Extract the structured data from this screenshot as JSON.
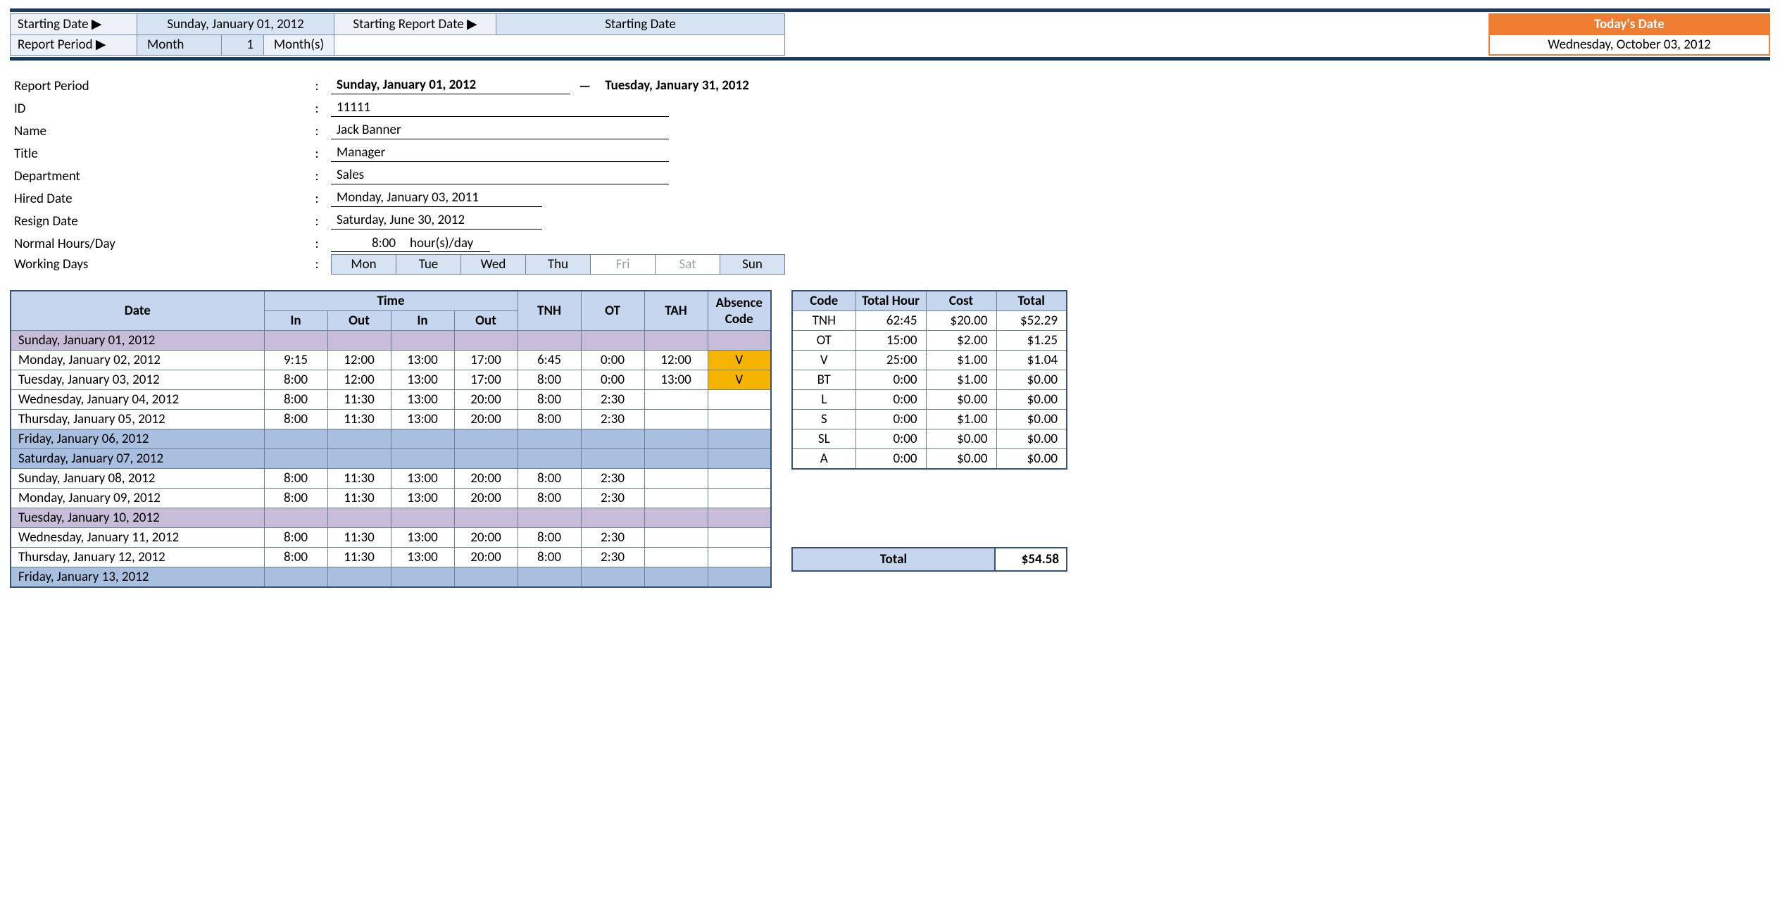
{
  "header": {
    "starting_date_label": "Starting Date ▶",
    "starting_date_value": "Sunday, January 01, 2012",
    "report_period_label": "Report Period ▶",
    "report_period_unit": "Month",
    "report_period_count": "1",
    "report_period_units": "Month(s)",
    "starting_report_date_label": "Starting Report Date ▶",
    "starting_report_value": "Starting Date",
    "today_label": "Today's Date",
    "today_value": "Wednesday, October 03, 2012"
  },
  "info": {
    "period_label": "Report Period",
    "period_from": "Sunday, January 01, 2012",
    "period_dash": "—",
    "period_to": "Tuesday, January 31, 2012",
    "id_label": "ID",
    "id_value": "11111",
    "name_label": "Name",
    "name_value": "Jack Banner",
    "title_label": "Title",
    "title_value": "Manager",
    "dept_label": "Department",
    "dept_value": "Sales",
    "hired_label": "Hired Date",
    "hired_value": "Monday, January 03, 2011",
    "resign_label": "Resign Date",
    "resign_value": "Saturday, June 30, 2012",
    "hours_label": "Normal Hours/Day",
    "hours_value": "8:00",
    "hours_unit": "hour(s)/day",
    "days_label": "Working Days",
    "days": [
      "Mon",
      "Tue",
      "Wed",
      "Thu",
      "Fri",
      "Sat",
      "Sun"
    ],
    "days_inactive": [
      false,
      false,
      false,
      false,
      true,
      true,
      false
    ]
  },
  "timesheet": {
    "headers": {
      "date": "Date",
      "time": "Time",
      "in": "In",
      "out": "Out",
      "tnh": "TNH",
      "ot": "OT",
      "tah": "TAH",
      "abs": "Absence Code"
    },
    "rows": [
      {
        "date": "Sunday, January 01, 2012",
        "cls": "row-purple"
      },
      {
        "date": "Monday, January 02, 2012",
        "cls": "row-white",
        "in1": "9:15",
        "out1": "12:00",
        "in2": "13:00",
        "out2": "17:00",
        "tnh": "6:45",
        "ot": "0:00",
        "tah": "12:00",
        "abs": "V",
        "amber": true
      },
      {
        "date": "Tuesday, January 03, 2012",
        "cls": "row-white",
        "in1": "8:00",
        "out1": "12:00",
        "in2": "13:00",
        "out2": "17:00",
        "tnh": "8:00",
        "ot": "0:00",
        "tah": "13:00",
        "abs": "V",
        "amber": true
      },
      {
        "date": "Wednesday, January 04, 2012",
        "cls": "row-white",
        "in1": "8:00",
        "out1": "11:30",
        "in2": "13:00",
        "out2": "20:00",
        "tnh": "8:00",
        "ot": "2:30"
      },
      {
        "date": "Thursday, January 05, 2012",
        "cls": "row-white",
        "in1": "8:00",
        "out1": "11:30",
        "in2": "13:00",
        "out2": "20:00",
        "tnh": "8:00",
        "ot": "2:30"
      },
      {
        "date": "Friday, January 06, 2012",
        "cls": "row-blue"
      },
      {
        "date": "Saturday, January 07, 2012",
        "cls": "row-blue"
      },
      {
        "date": "Sunday, January 08, 2012",
        "cls": "row-white",
        "in1": "8:00",
        "out1": "11:30",
        "in2": "13:00",
        "out2": "20:00",
        "tnh": "8:00",
        "ot": "2:30"
      },
      {
        "date": "Monday, January 09, 2012",
        "cls": "row-white",
        "in1": "8:00",
        "out1": "11:30",
        "in2": "13:00",
        "out2": "20:00",
        "tnh": "8:00",
        "ot": "2:30"
      },
      {
        "date": "Tuesday, January 10, 2012",
        "cls": "row-purple"
      },
      {
        "date": "Wednesday, January 11, 2012",
        "cls": "row-white",
        "in1": "8:00",
        "out1": "11:30",
        "in2": "13:00",
        "out2": "20:00",
        "tnh": "8:00",
        "ot": "2:30"
      },
      {
        "date": "Thursday, January 12, 2012",
        "cls": "row-white",
        "in1": "8:00",
        "out1": "11:30",
        "in2": "13:00",
        "out2": "20:00",
        "tnh": "8:00",
        "ot": "2:30"
      },
      {
        "date": "Friday, January 13, 2012",
        "cls": "row-blue"
      }
    ]
  },
  "summary": {
    "headers": {
      "code": "Code",
      "hour": "Total Hour",
      "cost": "Cost",
      "total": "Total"
    },
    "rows": [
      {
        "code": "TNH",
        "hour": "62:45",
        "cost": "$20.00",
        "total": "$52.29"
      },
      {
        "code": "OT",
        "hour": "15:00",
        "cost": "$2.00",
        "total": "$1.25"
      },
      {
        "code": "V",
        "hour": "25:00",
        "cost": "$1.00",
        "total": "$1.04"
      },
      {
        "code": "BT",
        "hour": "0:00",
        "cost": "$1.00",
        "total": "$0.00"
      },
      {
        "code": "L",
        "hour": "0:00",
        "cost": "$0.00",
        "total": "$0.00"
      },
      {
        "code": "S",
        "hour": "0:00",
        "cost": "$1.00",
        "total": "$0.00"
      },
      {
        "code": "SL",
        "hour": "0:00",
        "cost": "$0.00",
        "total": "$0.00"
      },
      {
        "code": "A",
        "hour": "0:00",
        "cost": "$0.00",
        "total": "$0.00"
      }
    ],
    "grand_label": "Total",
    "grand_value": "$54.58"
  }
}
